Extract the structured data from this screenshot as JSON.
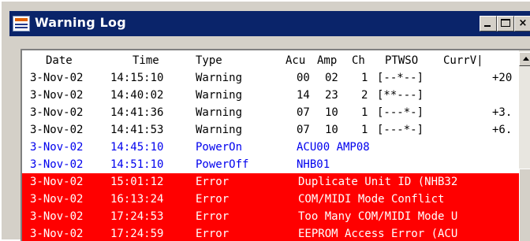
{
  "window": {
    "title": "Warning Log",
    "icon": "log-window-icon"
  },
  "columns": {
    "date": "Date",
    "time": "Time",
    "type": "Type",
    "acu": "Acu",
    "amp": "Amp",
    "ch": "Ch",
    "ptwso": "PTWSO",
    "currv": "CurrV|"
  },
  "rows": [
    {
      "kind": "warning",
      "date": "3-Nov-02",
      "time": "14:15:10",
      "type": "Warning",
      "acu": "00",
      "amp": "02",
      "ch": "1",
      "ptwso": "[--*--]",
      "curr": "+20"
    },
    {
      "kind": "warning",
      "date": "3-Nov-02",
      "time": "14:40:02",
      "type": "Warning",
      "acu": "14",
      "amp": "23",
      "ch": "2",
      "ptwso": "[**---]",
      "curr": ""
    },
    {
      "kind": "warning",
      "date": "3-Nov-02",
      "time": "14:41:36",
      "type": "Warning",
      "acu": "07",
      "amp": "10",
      "ch": "1",
      "ptwso": "[---*-]",
      "curr": "+3."
    },
    {
      "kind": "warning",
      "date": "3-Nov-02",
      "time": "14:41:53",
      "type": "Warning",
      "acu": "07",
      "amp": "10",
      "ch": "1",
      "ptwso": "[---*-]",
      "curr": "+6."
    },
    {
      "kind": "info",
      "date": "3-Nov-02",
      "time": "14:45:10",
      "type": "PowerOn",
      "message": "ACU00 AMP08"
    },
    {
      "kind": "info",
      "date": "3-Nov-02",
      "time": "14:51:10",
      "type": "PowerOff",
      "message": "NHB01"
    },
    {
      "kind": "error",
      "date": "3-Nov-02",
      "time": "15:01:12",
      "type": "Error",
      "message": "Duplicate Unit ID (NHB32"
    },
    {
      "kind": "error",
      "date": "3-Nov-02",
      "time": "16:13:24",
      "type": "Error",
      "message": "COM/MIDI Mode Conflict"
    },
    {
      "kind": "error",
      "date": "3-Nov-02",
      "time": "17:24:53",
      "type": "Error",
      "message": "Too Many COM/MIDI Mode U"
    },
    {
      "kind": "error",
      "date": "3-Nov-02",
      "time": "17:24:59",
      "type": "Error",
      "message": "EEPROM Access Error (ACU"
    }
  ],
  "colors": {
    "title_bar": "#0a246a",
    "info_text": "#0000ee",
    "error_bg": "#ff0000",
    "error_text": "#ffffff"
  }
}
